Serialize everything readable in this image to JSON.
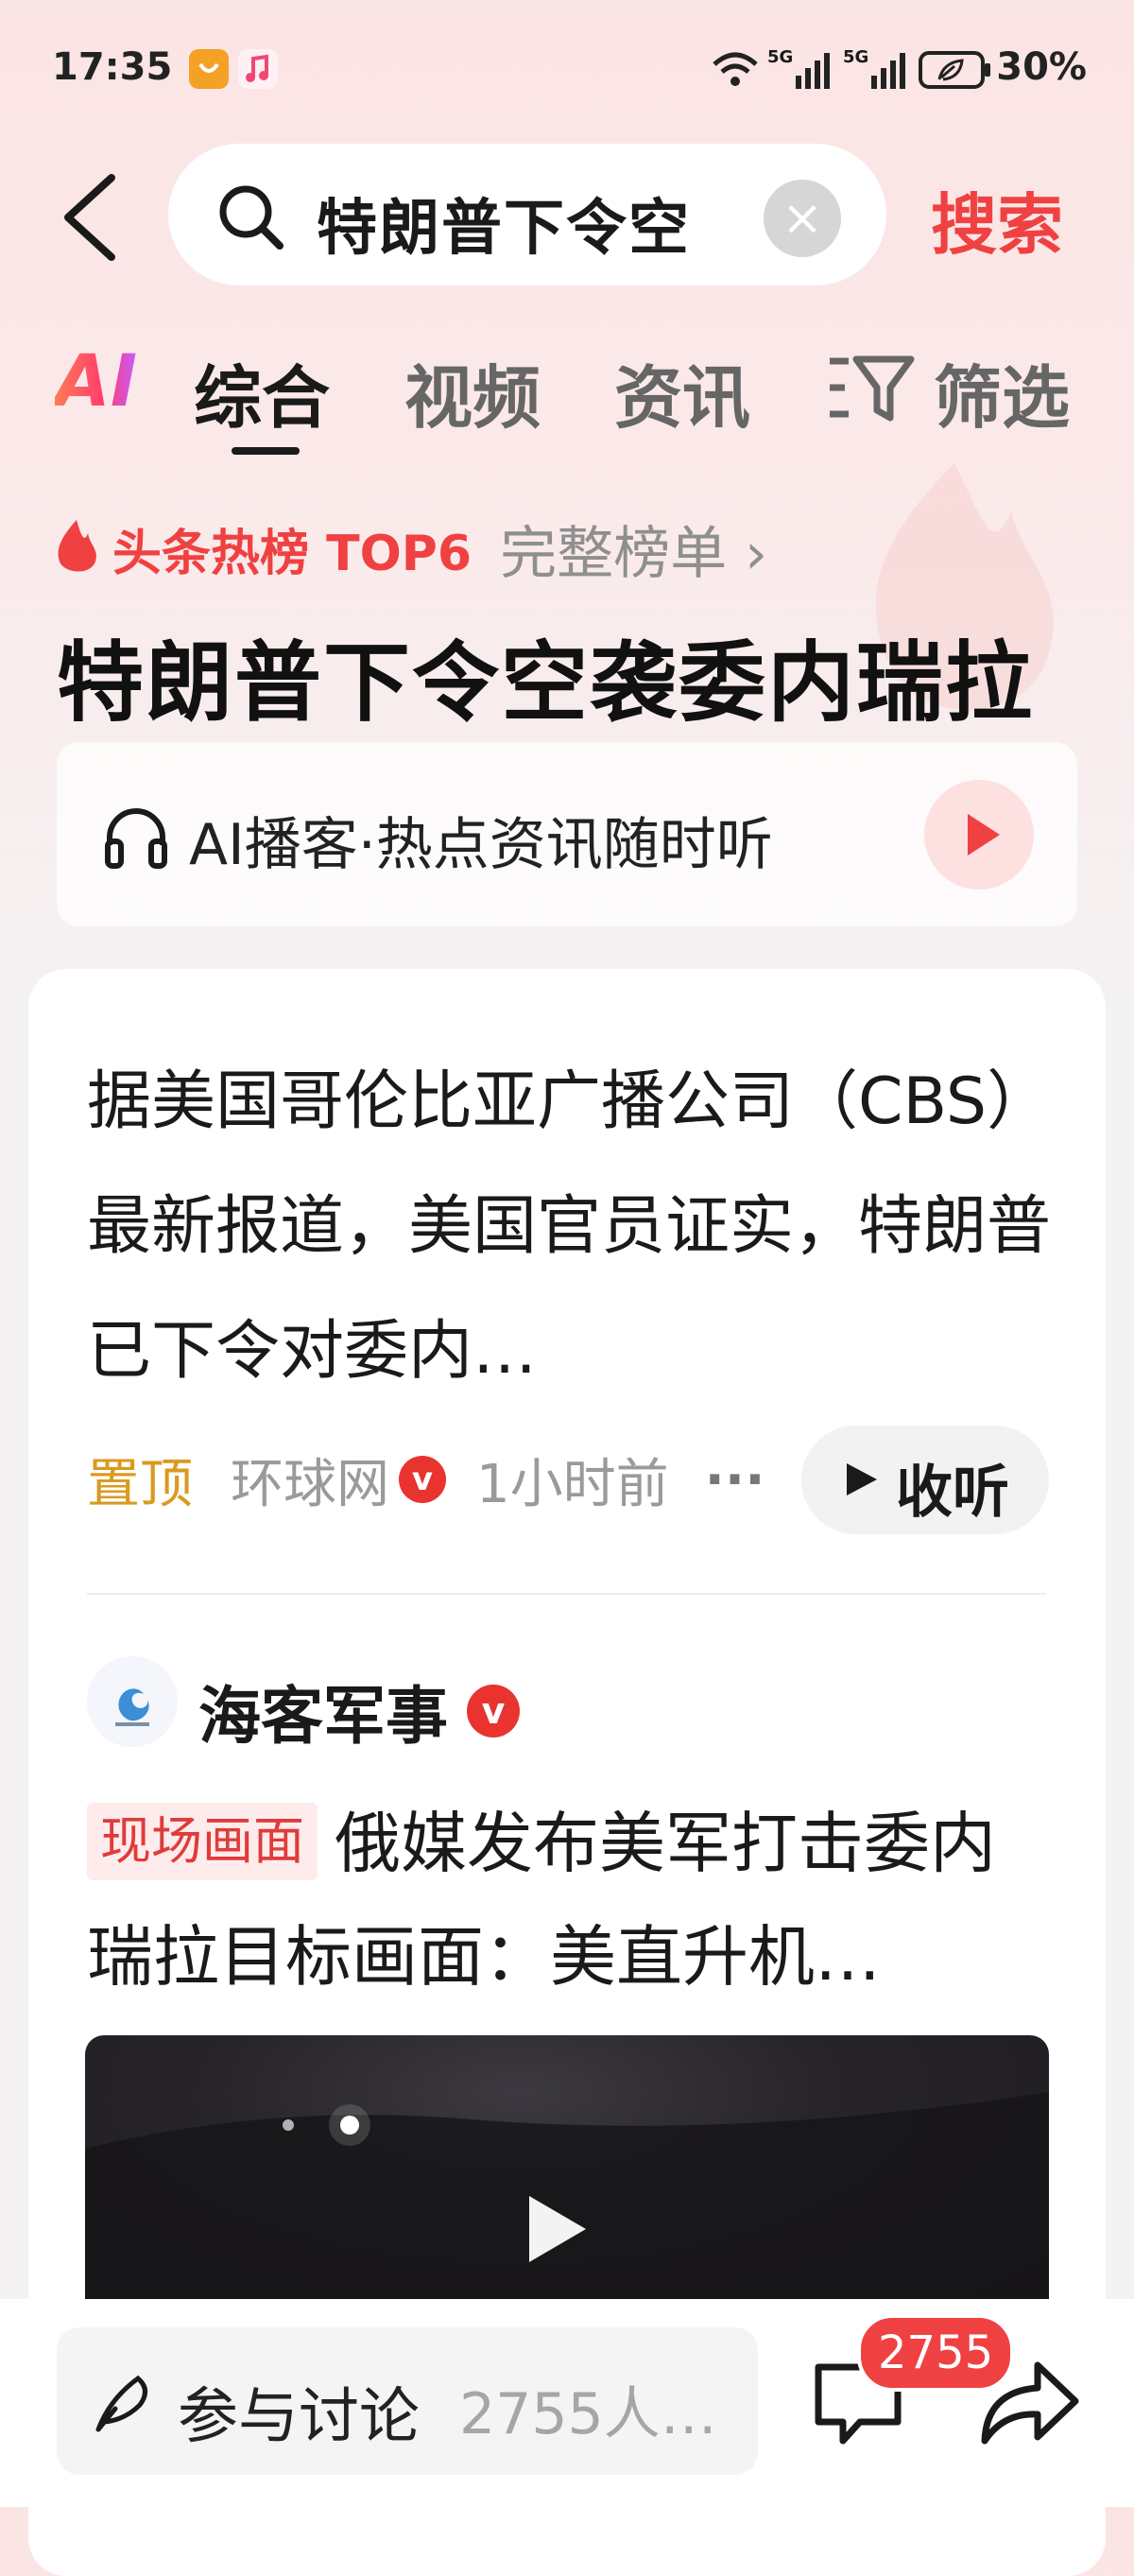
{
  "status_bar": {
    "time": "17:35",
    "battery_percent": "30%",
    "signal_labels": [
      "5G",
      "5G"
    ]
  },
  "header": {
    "search_query": "特朗普下令空",
    "search_button": "搜索"
  },
  "tabs": [
    {
      "label": "AI"
    },
    {
      "label": "综合",
      "active": true
    },
    {
      "label": "视频"
    },
    {
      "label": "资讯"
    },
    {
      "label": "筛选"
    }
  ],
  "hot_rank": {
    "tag": "头条热榜 TOP6",
    "full_list": "完整榜单 ›",
    "title": "特朗普下令空袭委内瑞拉"
  },
  "podcast": {
    "label": "AI播客·热点资讯随时听"
  },
  "top_news": {
    "summary": "据美国哥伦比亚广播公司（CBS）最新报道，美国官员证实，特朗普已下令对委内…",
    "pinned": "置顶",
    "source": "环球网",
    "verified_mark": "v",
    "time": "1小时前",
    "more": "···",
    "listen_button": "收听"
  },
  "feed_item": {
    "author": "海客军事",
    "verified_mark": "v",
    "tag": "现场画面",
    "title": "俄媒发布美军打击委内瑞拉目标画面：美直升机…"
  },
  "bottom_bar": {
    "discuss_label": "参与讨论",
    "discuss_count": "2755人…",
    "comment_count": "2755"
  },
  "colors": {
    "accent": "#f04142",
    "pinned": "#d99a1f"
  }
}
